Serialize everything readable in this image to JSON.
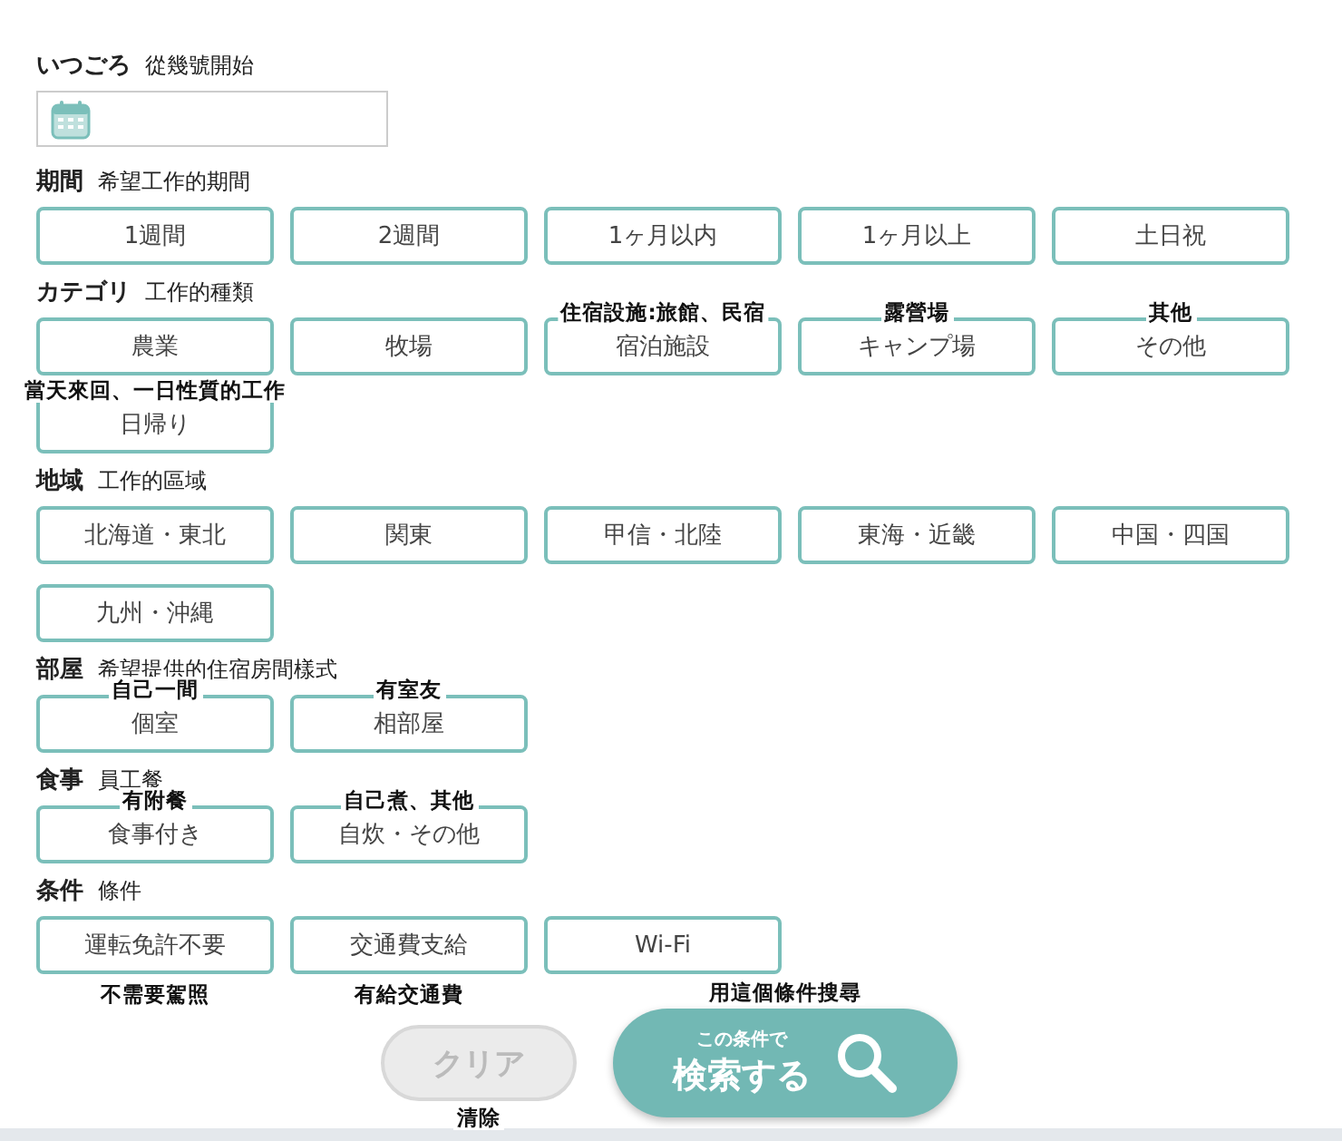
{
  "sections": [
    {
      "kind": "date",
      "label": "いつごろ",
      "note": "從幾號開始"
    },
    {
      "kind": "options",
      "label": "期間",
      "note": "希望工作的期間",
      "options": [
        {
          "label": "1週間"
        },
        {
          "label": "2週間"
        },
        {
          "label": "1ヶ月以内"
        },
        {
          "label": "1ヶ月以上"
        },
        {
          "label": "土日祝"
        }
      ]
    },
    {
      "kind": "options",
      "label": "カテゴリ",
      "note": "工作的種類",
      "options": [
        {
          "label": "農業"
        },
        {
          "label": "牧場"
        },
        {
          "label": "宿泊施設",
          "note": "住宿設施:旅館、民宿",
          "note_below": false
        },
        {
          "label": "キャンプ場",
          "note": "露營場",
          "note_below": false
        },
        {
          "label": "その他",
          "note": "其他",
          "note_below": false
        },
        {
          "label": "日帰り",
          "note": "當天來回、一日性質的工作",
          "note_below": false
        }
      ]
    },
    {
      "kind": "options",
      "label": "地域",
      "note": "工作的區域",
      "options": [
        {
          "label": "北海道・東北"
        },
        {
          "label": "関東"
        },
        {
          "label": "甲信・北陸"
        },
        {
          "label": "東海・近畿"
        },
        {
          "label": "中国・四国"
        },
        {
          "label": "九州・沖縄"
        }
      ]
    },
    {
      "kind": "options",
      "label": "部屋",
      "note": "希望提供的住宿房間樣式",
      "options": [
        {
          "label": "個室",
          "note": "自己一間",
          "note_below": false
        },
        {
          "label": "相部屋",
          "note": "有室友",
          "note_below": false
        }
      ]
    },
    {
      "kind": "options",
      "label": "食事",
      "note": "員工餐",
      "options": [
        {
          "label": "食事付き",
          "note": "有附餐",
          "note_below": false
        },
        {
          "label": "自炊・その他",
          "note": "自己煮、其他",
          "note_below": false
        }
      ]
    },
    {
      "kind": "options",
      "label": "条件",
      "note": "條件",
      "options": [
        {
          "label": "運転免許不要",
          "note": "不需要駕照",
          "note_below": true
        },
        {
          "label": "交通費支給",
          "note": "有給交通費",
          "note_below": true
        },
        {
          "label": "Wi-Fi"
        }
      ]
    }
  ],
  "actions": {
    "clear": {
      "label": "クリア",
      "note": "清除"
    },
    "search": {
      "caption": "この条件で",
      "label": "検索する",
      "note": "用這個條件搜尋"
    }
  }
}
